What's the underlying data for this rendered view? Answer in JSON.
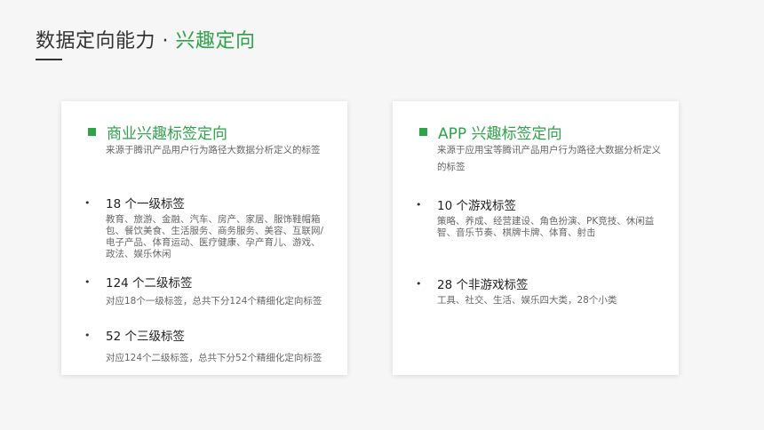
{
  "page": {
    "title_main": "数据定向能力 · ",
    "title_accent": "兴趣定向"
  },
  "left_card": {
    "heading": "商业兴趣标签定向",
    "subtitle": "来源于腾讯产品用户行为路径大数据分析定义的标签",
    "items": [
      {
        "title": "18 个一级标签",
        "desc": "教育、旅游、金融、汽车、房产、家居、服饰鞋帽箱包、餐饮美食、生活服务、商务服务、美容、互联网/电子产品、体育运动、医疗健康、孕产育儿、游戏、政法、娱乐休闲"
      },
      {
        "title": "124 个二级标签",
        "desc": "对应18个一级标签，总共下分124个精细化定向标签"
      },
      {
        "title": "52 个三级标签",
        "desc": "对应124个二级标签，总共下分52个精细化定向标签"
      }
    ]
  },
  "right_card": {
    "heading": "APP 兴趣标签定向",
    "subtitle": "来源于应用宝等腾讯产品用户行为路径大数据分析定义的标签",
    "items": [
      {
        "title": "10 个游戏标签",
        "desc": "策略、养成、经营建设、角色扮演、PK竞技、休闲益智、音乐节奏、棋牌卡牌、体育、射击"
      },
      {
        "title": "28 个非游戏标签",
        "desc": "工具、社交、生活、娱乐四大类，28个小类"
      }
    ]
  },
  "bullet_glyph": "•",
  "colors": {
    "accent": "#2fa24a",
    "text": "#333333",
    "muted": "#666666"
  }
}
